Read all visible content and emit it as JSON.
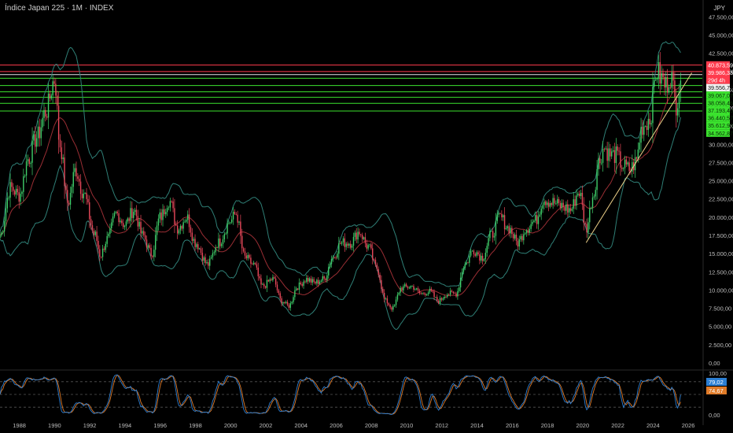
{
  "header": {
    "title": "Índice Japan 225 · 1M · INDEX",
    "currency": "JPY"
  },
  "chart_data": [
    {
      "type": "candlestick",
      "title": "Índice Japan 225 · 1M · INDEX",
      "xlabel": "",
      "ylabel": "",
      "x_ticks": [
        "1988",
        "1990",
        "1992",
        "1994",
        "1996",
        "1998",
        "2000",
        "2002",
        "2004",
        "2006",
        "2008",
        "2010",
        "2012",
        "2014",
        "2016",
        "2018",
        "2020",
        "2022",
        "2024",
        "2026"
      ],
      "y_ticks": [
        "0,00",
        "2.500,00",
        "5.000,00",
        "7.500,00",
        "10.000,00",
        "12.500,00",
        "15.000,00",
        "17.500,00",
        "20.000,00",
        "22.500,00",
        "25.000,00",
        "27.500,00",
        "30.000,00",
        "32.500,00",
        "35.000,00",
        "37.500,00",
        "40.000,00",
        "42.500,00",
        "45.000,00",
        "47.500,00"
      ],
      "ylim": [
        0,
        48500
      ],
      "xlim": [
        1986.9,
        2026.8
      ],
      "closes": [
        {
          "t": 1986.9,
          "v": 17500
        },
        {
          "t": 1987.5,
          "v": 24000
        },
        {
          "t": 1988.0,
          "v": 23000
        },
        {
          "t": 1988.5,
          "v": 28000
        },
        {
          "t": 1989.0,
          "v": 31000
        },
        {
          "t": 1989.5,
          "v": 34500
        },
        {
          "t": 1990.0,
          "v": 38900
        },
        {
          "t": 1990.3,
          "v": 30000
        },
        {
          "t": 1990.75,
          "v": 22000
        },
        {
          "t": 1991.2,
          "v": 26500
        },
        {
          "t": 1991.6,
          "v": 23500
        },
        {
          "t": 1992.3,
          "v": 17500
        },
        {
          "t": 1992.6,
          "v": 14800
        },
        {
          "t": 1993.0,
          "v": 17000
        },
        {
          "t": 1993.5,
          "v": 20500
        },
        {
          "t": 1994.0,
          "v": 19000
        },
        {
          "t": 1994.5,
          "v": 21000
        },
        {
          "t": 1995.0,
          "v": 17500
        },
        {
          "t": 1995.5,
          "v": 15000
        },
        {
          "t": 1996.0,
          "v": 20000
        },
        {
          "t": 1996.5,
          "v": 22300
        },
        {
          "t": 1997.0,
          "v": 18500
        },
        {
          "t": 1997.5,
          "v": 20000
        },
        {
          "t": 1998.0,
          "v": 16500
        },
        {
          "t": 1998.7,
          "v": 13500
        },
        {
          "t": 1999.3,
          "v": 16500
        },
        {
          "t": 2000.0,
          "v": 19500
        },
        {
          "t": 2000.3,
          "v": 20500
        },
        {
          "t": 2000.8,
          "v": 14500
        },
        {
          "t": 2001.3,
          "v": 13500
        },
        {
          "t": 2001.8,
          "v": 10500
        },
        {
          "t": 2002.4,
          "v": 11500
        },
        {
          "t": 2002.9,
          "v": 8500
        },
        {
          "t": 2003.3,
          "v": 7800
        },
        {
          "t": 2003.8,
          "v": 10500
        },
        {
          "t": 2004.3,
          "v": 11500
        },
        {
          "t": 2004.8,
          "v": 11000
        },
        {
          "t": 2005.3,
          "v": 11500
        },
        {
          "t": 2005.8,
          "v": 14500
        },
        {
          "t": 2006.3,
          "v": 16500
        },
        {
          "t": 2006.8,
          "v": 16500
        },
        {
          "t": 2007.3,
          "v": 18000
        },
        {
          "t": 2007.8,
          "v": 16000
        },
        {
          "t": 2008.3,
          "v": 13000
        },
        {
          "t": 2008.8,
          "v": 8500
        },
        {
          "t": 2009.2,
          "v": 7500
        },
        {
          "t": 2009.7,
          "v": 10300
        },
        {
          "t": 2010.3,
          "v": 10500
        },
        {
          "t": 2010.8,
          "v": 9500
        },
        {
          "t": 2011.3,
          "v": 9800
        },
        {
          "t": 2011.8,
          "v": 8500
        },
        {
          "t": 2012.3,
          "v": 9500
        },
        {
          "t": 2012.8,
          "v": 9500
        },
        {
          "t": 2013.3,
          "v": 13500
        },
        {
          "t": 2013.8,
          "v": 15500
        },
        {
          "t": 2014.3,
          "v": 14500
        },
        {
          "t": 2014.8,
          "v": 17500
        },
        {
          "t": 2015.3,
          "v": 20000
        },
        {
          "t": 2015.8,
          "v": 18500
        },
        {
          "t": 2016.3,
          "v": 16500
        },
        {
          "t": 2016.8,
          "v": 18500
        },
        {
          "t": 2017.3,
          "v": 19500
        },
        {
          "t": 2017.8,
          "v": 22500
        },
        {
          "t": 2018.3,
          "v": 22000
        },
        {
          "t": 2018.8,
          "v": 21500
        },
        {
          "t": 2019.3,
          "v": 21000
        },
        {
          "t": 2019.8,
          "v": 23500
        },
        {
          "t": 2020.2,
          "v": 18500
        },
        {
          "t": 2020.6,
          "v": 23000
        },
        {
          "t": 2020.9,
          "v": 27500
        },
        {
          "t": 2021.2,
          "v": 29500
        },
        {
          "t": 2021.6,
          "v": 28500
        },
        {
          "t": 2021.9,
          "v": 28500
        },
        {
          "t": 2022.3,
          "v": 27000
        },
        {
          "t": 2022.7,
          "v": 26500
        },
        {
          "t": 2023.0,
          "v": 27500
        },
        {
          "t": 2023.4,
          "v": 32500
        },
        {
          "t": 2023.8,
          "v": 33500
        },
        {
          "t": 2024.2,
          "v": 40000
        },
        {
          "t": 2024.5,
          "v": 39000
        },
        {
          "t": 2024.7,
          "v": 38000
        },
        {
          "t": 2025.0,
          "v": 39500
        },
        {
          "t": 2025.3,
          "v": 35500
        },
        {
          "t": 2025.6,
          "v": 39600
        }
      ],
      "levels": {
        "red": [
          "40.873,59",
          "39.986,33"
        ],
        "white": "39.556,73",
        "green": [
          "39.067,07",
          "38.058,46",
          "37.193,40",
          "36.440,57",
          "35.612,90",
          "34.562,87"
        ],
        "countdown": "29d 4h"
      },
      "trendline": {
        "from": {
          "t": 2020.2,
          "v": 16500
        },
        "to": {
          "t": 2026.2,
          "v": 39800
        }
      },
      "oscillator": {
        "y_ticks": [
          "100,00",
          "0,00"
        ],
        "k_value": "79,02",
        "d_value": "74,67"
      },
      "colors": {
        "up": "#3fcf6a",
        "down": "#e8485a",
        "band": "#2f7f76",
        "ma": "#9a2e34",
        "level_red": "#ff3b4d",
        "level_green": "#3be22e",
        "trend": "#efd28a",
        "osc_k": "#2c7fd3",
        "osc_d": "#e07b28"
      }
    }
  ]
}
